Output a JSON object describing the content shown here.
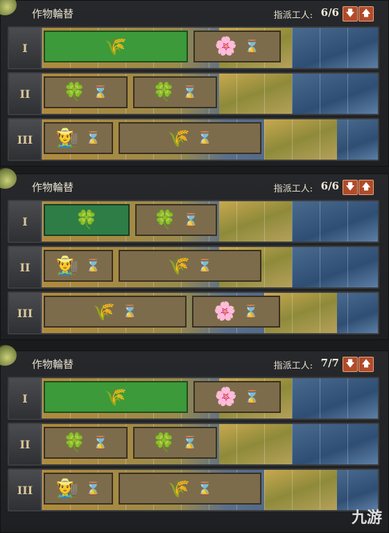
{
  "panels": [
    {
      "title": "作物輪替",
      "worker_label": "指派工人:",
      "worker_count": "6/6",
      "rows": [
        {
          "numeral": "I",
          "crops": [
            {
              "icon": "wheat-icon",
              "glyph": "🌾",
              "state": "active",
              "hourglass": false
            },
            {
              "icon": "flower-icon",
              "glyph": "🌸",
              "state": "normal",
              "hourglass": true
            }
          ]
        },
        {
          "numeral": "II",
          "crops": [
            {
              "icon": "clover-icon",
              "glyph": "🍀",
              "state": "normal",
              "hourglass": true
            },
            {
              "icon": "clover-icon",
              "glyph": "🍀",
              "state": "normal",
              "hourglass": true
            }
          ]
        },
        {
          "numeral": "III",
          "crops": [
            {
              "icon": "farmer-icon",
              "glyph": "👨‍🌾",
              "state": "normal",
              "hourglass": true
            },
            {
              "icon": "wheat-icon",
              "glyph": "🌾",
              "state": "normal",
              "hourglass": true
            }
          ]
        }
      ]
    },
    {
      "title": "作物輪替",
      "worker_label": "指派工人:",
      "worker_count": "6/6",
      "rows": [
        {
          "numeral": "I",
          "crops": [
            {
              "icon": "clover-icon",
              "glyph": "🍀",
              "state": "done",
              "hourglass": false
            },
            {
              "icon": "clover-icon",
              "glyph": "🍀",
              "state": "normal",
              "hourglass": true
            }
          ]
        },
        {
          "numeral": "II",
          "crops": [
            {
              "icon": "farmer-icon",
              "glyph": "👨‍🌾",
              "state": "normal",
              "hourglass": true
            },
            {
              "icon": "wheat-icon",
              "glyph": "🌾",
              "state": "normal",
              "hourglass": true
            }
          ]
        },
        {
          "numeral": "III",
          "crops": [
            {
              "icon": "wheat-icon",
              "glyph": "🌾",
              "state": "normal",
              "hourglass": true
            },
            {
              "icon": "flower-icon",
              "glyph": "🌸",
              "state": "normal",
              "hourglass": true
            }
          ]
        }
      ]
    },
    {
      "title": "作物輪替",
      "worker_label": "指派工人:",
      "worker_count": "7/7",
      "rows": [
        {
          "numeral": "I",
          "crops": [
            {
              "icon": "wheat-icon",
              "glyph": "🌾",
              "state": "active",
              "hourglass": false
            },
            {
              "icon": "flower-icon",
              "glyph": "🌸",
              "state": "normal",
              "hourglass": true
            }
          ]
        },
        {
          "numeral": "II",
          "crops": [
            {
              "icon": "clover-icon",
              "glyph": "🍀",
              "state": "normal",
              "hourglass": true
            },
            {
              "icon": "clover-icon",
              "glyph": "🍀",
              "state": "normal",
              "hourglass": true
            }
          ]
        },
        {
          "numeral": "III",
          "crops": [
            {
              "icon": "farmer-icon",
              "glyph": "👨‍🌾",
              "state": "normal",
              "hourglass": true
            },
            {
              "icon": "wheat-icon",
              "glyph": "🌾",
              "state": "normal",
              "hourglass": true
            }
          ]
        }
      ]
    }
  ],
  "buttons": {
    "down": "🡇",
    "up": "🡅"
  },
  "hourglass_glyph": "⌛",
  "watermark": "九游",
  "colors": {
    "panel_bg": "#26282b",
    "button": "#b24b2a",
    "completed_green": "#2e7d46",
    "active_green": "#3c9a3a",
    "crop_brown": "#7c6c4c",
    "numeral": "#dcc79a"
  }
}
